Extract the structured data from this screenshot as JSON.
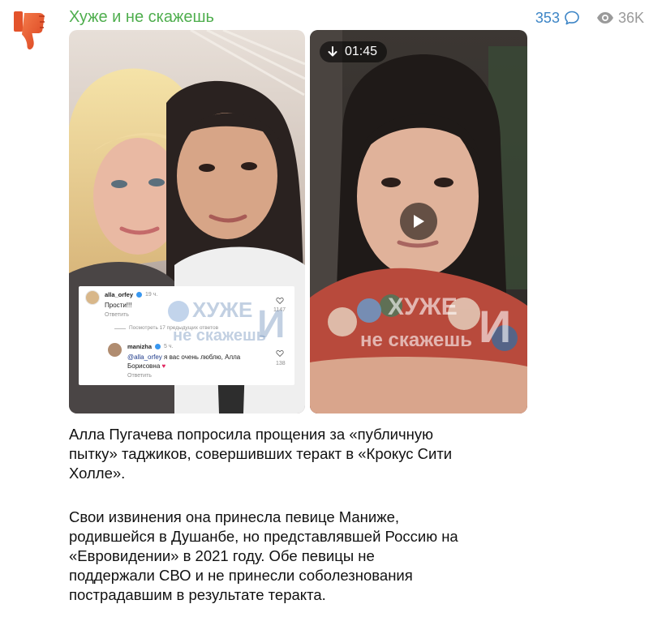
{
  "channel": {
    "name": "Хуже и не скажешь",
    "avatar_icon": "thumbs-down-icon",
    "accent": "#4fae4e"
  },
  "stats": {
    "comments": "353",
    "views": "36K",
    "comments_icon": "comment-bubble-icon",
    "views_icon": "eye-icon"
  },
  "media": {
    "photo": {
      "comment1_user": "alla_orfey",
      "comment1_time": "19 ч.",
      "comment1_text": "Прости!!!",
      "comment1_reply": "Ответить",
      "comment1_likes": "1147",
      "view_more": "Посмотреть 17 предыдущих ответов",
      "comment2_user": "manizha",
      "comment2_time": "5 ч.",
      "comment2_mention": "@alla_orfey",
      "comment2_text_a": " я вас очень люблю, Алла",
      "comment2_text_b": "Борисовна",
      "comment2_reply": "Ответить",
      "comment2_likes": "138",
      "watermark_a": "ХУЖЕ",
      "watermark_b": "не скажешь",
      "watermark_c": "И"
    },
    "video": {
      "duration": "01:45",
      "watermark_a": "ХУЖЕ",
      "watermark_b": "не скажешь",
      "watermark_c": "И"
    }
  },
  "post": {
    "p1": [
      "Алла Пугачева попросила прощения за «публичную",
      "пытку» таджиков, совершивших теракт в «Крокус Сити",
      "Холле»."
    ],
    "p2": [
      "Свои извинения она принесла певице Манижe,",
      "родившейся в Душанбе, но представлявшей Россию на",
      "«Евровидении» в 2021 году. Обе певицы не",
      "поддержали СВО и не принесли соболезнования",
      "пострадавшим в результате теракта."
    ]
  }
}
